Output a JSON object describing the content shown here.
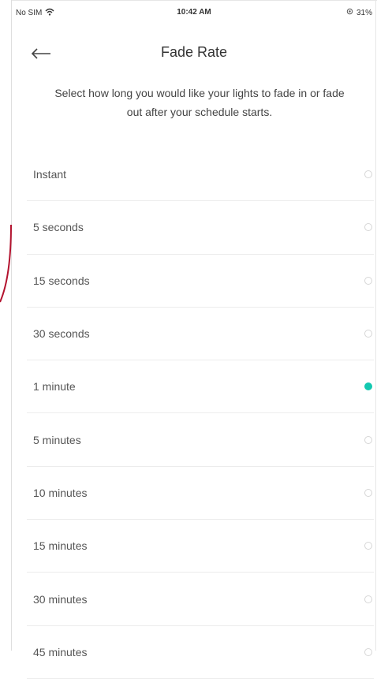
{
  "status_bar": {
    "carrier": "No SIM",
    "time": "10:42 AM",
    "battery": "31%"
  },
  "header": {
    "title": "Fade Rate"
  },
  "description": "Select how long you would like your lights to fade in or fade out after your schedule starts.",
  "options": [
    {
      "label": "Instant",
      "selected": false
    },
    {
      "label": "5 seconds",
      "selected": false
    },
    {
      "label": "15 seconds",
      "selected": false
    },
    {
      "label": "30 seconds",
      "selected": false
    },
    {
      "label": "1 minute",
      "selected": true
    },
    {
      "label": "5 minutes",
      "selected": false
    },
    {
      "label": "10 minutes",
      "selected": false
    },
    {
      "label": "15 minutes",
      "selected": false
    },
    {
      "label": "30 minutes",
      "selected": false
    },
    {
      "label": "45 minutes",
      "selected": false
    }
  ],
  "colors": {
    "accent": "#13c8b0",
    "annotation": "#b3122e"
  },
  "icons": [
    "back-arrow-icon",
    "wifi-icon",
    "location-icon"
  ]
}
